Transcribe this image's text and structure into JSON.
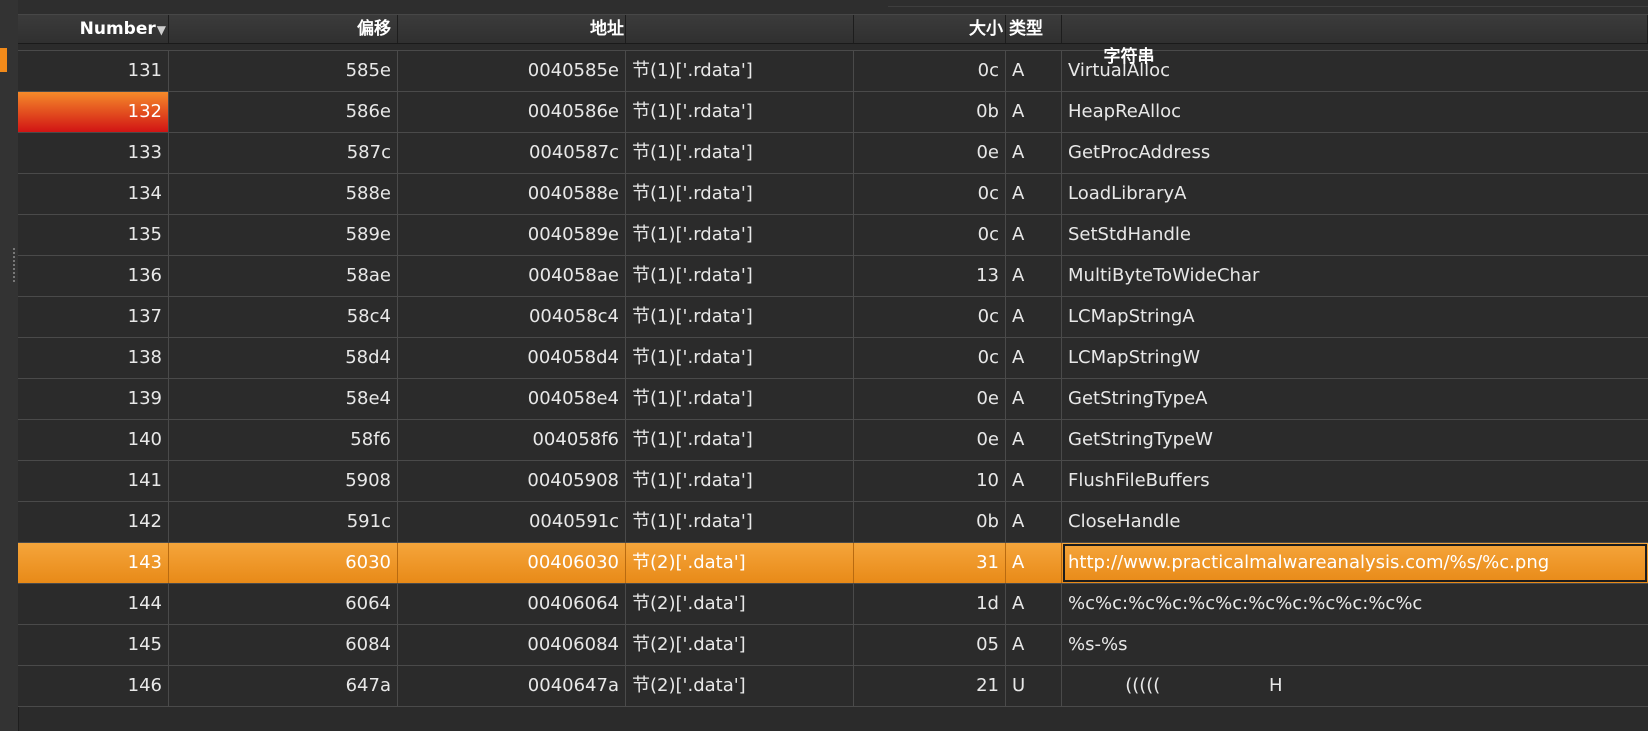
{
  "columns": {
    "number": "Number",
    "offset": "偏移",
    "address": "地址",
    "size": "大小",
    "type": "类型",
    "string": "字符串"
  },
  "sort_indicator": "▼",
  "rows": [
    {
      "number": "131",
      "offset": "585e",
      "address": "0040585e",
      "section": "节(1)['.rdata']",
      "size": "0c",
      "type": "A",
      "string": "VirtualAlloc"
    },
    {
      "number": "132",
      "offset": "586e",
      "address": "0040586e",
      "section": "节(1)['.rdata']",
      "size": "0b",
      "type": "A",
      "string": "HeapReAlloc"
    },
    {
      "number": "133",
      "offset": "587c",
      "address": "0040587c",
      "section": "节(1)['.rdata']",
      "size": "0e",
      "type": "A",
      "string": "GetProcAddress"
    },
    {
      "number": "134",
      "offset": "588e",
      "address": "0040588e",
      "section": "节(1)['.rdata']",
      "size": "0c",
      "type": "A",
      "string": "LoadLibraryA"
    },
    {
      "number": "135",
      "offset": "589e",
      "address": "0040589e",
      "section": "节(1)['.rdata']",
      "size": "0c",
      "type": "A",
      "string": "SetStdHandle"
    },
    {
      "number": "136",
      "offset": "58ae",
      "address": "004058ae",
      "section": "节(1)['.rdata']",
      "size": "13",
      "type": "A",
      "string": "MultiByteToWideChar"
    },
    {
      "number": "137",
      "offset": "58c4",
      "address": "004058c4",
      "section": "节(1)['.rdata']",
      "size": "0c",
      "type": "A",
      "string": "LCMapStringA"
    },
    {
      "number": "138",
      "offset": "58d4",
      "address": "004058d4",
      "section": "节(1)['.rdata']",
      "size": "0c",
      "type": "A",
      "string": "LCMapStringW"
    },
    {
      "number": "139",
      "offset": "58e4",
      "address": "004058e4",
      "section": "节(1)['.rdata']",
      "size": "0e",
      "type": "A",
      "string": "GetStringTypeA"
    },
    {
      "number": "140",
      "offset": "58f6",
      "address": "004058f6",
      "section": "节(1)['.rdata']",
      "size": "0e",
      "type": "A",
      "string": "GetStringTypeW"
    },
    {
      "number": "141",
      "offset": "5908",
      "address": "00405908",
      "section": "节(1)['.rdata']",
      "size": "10",
      "type": "A",
      "string": "FlushFileBuffers"
    },
    {
      "number": "142",
      "offset": "591c",
      "address": "0040591c",
      "section": "节(1)['.rdata']",
      "size": "0b",
      "type": "A",
      "string": "CloseHandle"
    },
    {
      "number": "143",
      "offset": "6030",
      "address": "00406030",
      "section": "节(2)['.data']",
      "size": "31",
      "type": "A",
      "string": "http://www.practicalmalwareanalysis.com/%s/%c.png"
    },
    {
      "number": "144",
      "offset": "6064",
      "address": "00406064",
      "section": "节(2)['.data']",
      "size": "1d",
      "type": "A",
      "string": "%c%c:%c%c:%c%c:%c%c:%c%c:%c%c"
    },
    {
      "number": "145",
      "offset": "6084",
      "address": "00406084",
      "section": "节(2)['.data']",
      "size": "05",
      "type": "A",
      "string": "%s-%s"
    },
    {
      "number": "146",
      "offset": "647a",
      "address": "0040647a",
      "section": "节(2)['.data']",
      "size": "21",
      "type": "U",
      "string": "          (((((                   H"
    }
  ],
  "selected_row_number": "143",
  "flagged_row_number": "132",
  "colors": {
    "background": "#2b2b2b",
    "selection": "#f0961f",
    "flag": "#d11414",
    "gridline": "#4a4a4a"
  }
}
